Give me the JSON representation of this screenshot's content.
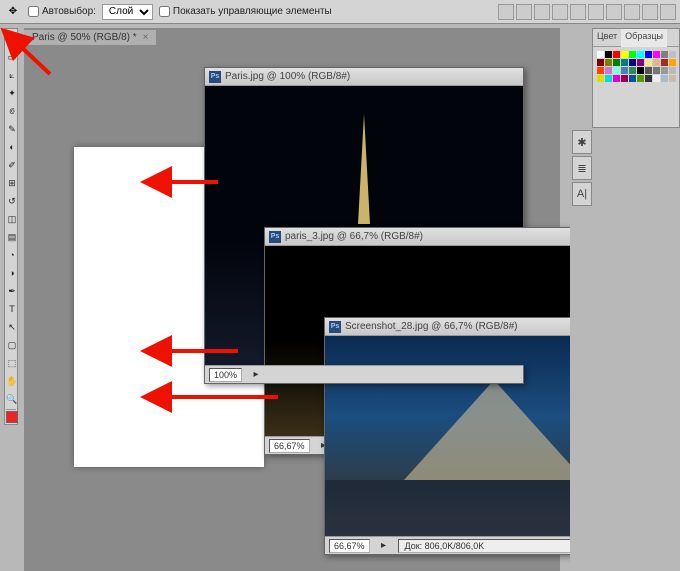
{
  "options_bar": {
    "autoselect_label": "Автовыбор:",
    "select_layer_label": "Слой",
    "show_controls_label": "Показать управляющие элементы"
  },
  "toolbox": {
    "tools": [
      {
        "name": "move-tool",
        "glyph": "✥"
      },
      {
        "name": "marquee-tool",
        "glyph": "▭"
      },
      {
        "name": "lasso-tool",
        "glyph": "⟀"
      },
      {
        "name": "wand-tool",
        "glyph": "✦"
      },
      {
        "name": "crop-tool",
        "glyph": "⟃"
      },
      {
        "name": "eyedropper-tool",
        "glyph": "✎"
      },
      {
        "name": "healing-tool",
        "glyph": "◐"
      },
      {
        "name": "brush-tool",
        "glyph": "✐"
      },
      {
        "name": "stamp-tool",
        "glyph": "⊞"
      },
      {
        "name": "history-brush-tool",
        "glyph": "↺"
      },
      {
        "name": "eraser-tool",
        "glyph": "◫"
      },
      {
        "name": "gradient-tool",
        "glyph": "▤"
      },
      {
        "name": "blur-tool",
        "glyph": "◔"
      },
      {
        "name": "dodge-tool",
        "glyph": "◑"
      },
      {
        "name": "pen-tool",
        "glyph": "✒"
      },
      {
        "name": "type-tool",
        "glyph": "T"
      },
      {
        "name": "path-tool",
        "glyph": "↖"
      },
      {
        "name": "shape-tool",
        "glyph": "▢"
      },
      {
        "name": "3d-tool",
        "glyph": "⬚"
      },
      {
        "name": "hand-tool",
        "glyph": "✋"
      },
      {
        "name": "zoom-tool",
        "glyph": "🔍"
      }
    ],
    "fg_color": "#ee2222",
    "bg_color": "#ffffff"
  },
  "doc_tab": {
    "label": "Paris @ 50% (RGB/8) *"
  },
  "windows": {
    "w1": {
      "title": "Paris.jpg @ 100% (RGB/8#)",
      "zoom": "100%",
      "info": ""
    },
    "w2": {
      "title": "paris_3.jpg @ 66,7% (RGB/8#)",
      "zoom": "66,67%",
      "info": ""
    },
    "w3": {
      "title": "Screenshot_28.jpg @ 66,7% (RGB/8#)",
      "zoom": "66,67%",
      "info": "Док: 806,0K/806,0K"
    }
  },
  "right": {
    "tab_color": "Цвет",
    "tab_swatches": "Образцы",
    "swatch_colors": [
      "#ffffff",
      "#000000",
      "#ff0000",
      "#ffff00",
      "#00ff00",
      "#00ffff",
      "#0000ff",
      "#ff00ff",
      "#808080",
      "#c0c0c0",
      "#800000",
      "#808000",
      "#008000",
      "#008080",
      "#000080",
      "#800080",
      "#f0e68c",
      "#deb887",
      "#a52a2a",
      "#ffa500",
      "#ff4500",
      "#da70d6",
      "#7fffd4",
      "#4682b4",
      "#2e8b57",
      "#000",
      "#555",
      "#777",
      "#999",
      "#bbb",
      "#dd0",
      "#0dd",
      "#d0d",
      "#905",
      "#059",
      "#590",
      "#333",
      "#eee",
      "#abc",
      "#cba"
    ],
    "panel_icons": [
      {
        "name": "navigator-icon",
        "glyph": "✱"
      },
      {
        "name": "history-icon",
        "glyph": "≣"
      },
      {
        "name": "character-icon",
        "glyph": "A|"
      }
    ]
  }
}
